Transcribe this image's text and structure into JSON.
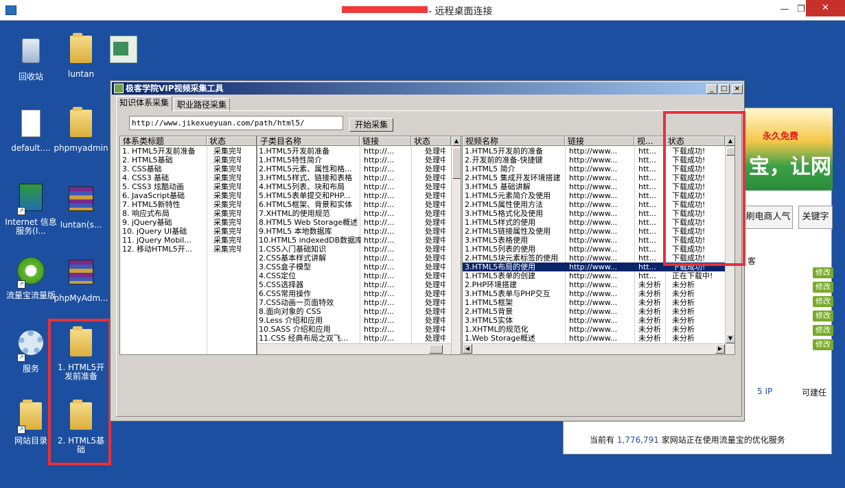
{
  "window": {
    "title": "- 远程桌面连接"
  },
  "desktop_icons": [
    {
      "label": "回收站"
    },
    {
      "label": "luntan"
    },
    {
      "label": "default...."
    },
    {
      "label": "phpmyadmin"
    },
    {
      "label": "Internet 信息服务(I..."
    },
    {
      "label": "luntan(s..."
    },
    {
      "label": "流量宝流量版"
    },
    {
      "label": "phpMyAdm..."
    },
    {
      "label": "服务"
    },
    {
      "label": "1. HTML5开发前准备"
    },
    {
      "label": "网站目录"
    },
    {
      "label": "2. HTML5基础"
    }
  ],
  "app": {
    "title": "极客学院VIP视频采集工具",
    "tabs": [
      "知识体系采集",
      "职业路径采集"
    ],
    "url": "http://www.jikexueyuan.com/path/html5/",
    "start_button": "开始采集",
    "list1": {
      "headers": [
        "体系类标题",
        "状态"
      ],
      "rows": [
        [
          "1. HTML5开发前准备",
          "采集完毕"
        ],
        [
          "2. HTML5基础",
          "采集完毕"
        ],
        [
          "3. CSS基础",
          "采集完毕"
        ],
        [
          "4. CSS3 基础",
          "采集完毕"
        ],
        [
          "5. CSS3 炫酷动画",
          "采集完毕"
        ],
        [
          "6. JavaScript基础",
          "采集完毕"
        ],
        [
          "7. HTML5新特性",
          "采集完毕"
        ],
        [
          "8. 响应式布局",
          "采集完毕"
        ],
        [
          "9. jQuery基础",
          "采集完毕"
        ],
        [
          "10. jQuery UI基础",
          "采集完毕"
        ],
        [
          "11. jQuery Mobil...",
          "采集完毕"
        ],
        [
          "12. 移动HTML5开...",
          "采集完毕"
        ]
      ]
    },
    "list2": {
      "headers": [
        "子类目名称",
        "链接",
        "状态"
      ],
      "rows": [
        [
          "1.HTML5开发前准备",
          "http://...",
          "处理中"
        ],
        [
          "1.HTML5特性简介",
          "http://...",
          "处理中"
        ],
        [
          "2.HTML5元素、属性和格...",
          "http://...",
          "处理中"
        ],
        [
          "3.HTML5样式、链接和表格",
          "http://...",
          "处理中"
        ],
        [
          "4.HTML5列表、块和布局",
          "http://...",
          "处理中"
        ],
        [
          "5.HTML5表单提交和PHP...",
          "http://...",
          "处理中"
        ],
        [
          "6.HTML5框架、背景和实体",
          "http://...",
          "处理中"
        ],
        [
          "7.XHTML的使用规范",
          "http://...",
          "处理中"
        ],
        [
          "8.HTML5 Web Storage概述",
          "http://...",
          "处理中"
        ],
        [
          "9.HTML5 本地数据库",
          "http://...",
          "处理中"
        ],
        [
          "10.HTML5 indexedDB数据库",
          "http://...",
          "处理中"
        ],
        [
          "1.CSS入门基础知识",
          "http://...",
          "处理中"
        ],
        [
          "2.CSS基本样式讲解",
          "http://...",
          "处理中"
        ],
        [
          "3.CSS盒子模型",
          "http://...",
          "处理中"
        ],
        [
          "4.CSS定位",
          "http://...",
          "处理中"
        ],
        [
          "5.CSS选择器",
          "http://...",
          "处理中"
        ],
        [
          "6.CSS常用操作",
          "http://...",
          "处理中"
        ],
        [
          "7.CSS动画一页面特效",
          "http://...",
          "处理中"
        ],
        [
          "8.面向对象的 CSS",
          "http://...",
          "处理中"
        ],
        [
          "9.Less 介绍和应用",
          "http://...",
          "处理中"
        ],
        [
          "10.SASS 介绍和应用",
          "http://...",
          "处理中"
        ],
        [
          "11.CSS 经典布局之双飞...",
          "http://...",
          "处理中"
        ]
      ]
    },
    "list3": {
      "headers": [
        "视频名称",
        "链接",
        "视...",
        "状态"
      ],
      "rows": [
        [
          "1.HTML5开发前的准备",
          "http://www...",
          "htt...",
          "下载成功!"
        ],
        [
          "2.开发前的准备-快捷键",
          "http://www...",
          "htt...",
          "下载成功!"
        ],
        [
          "1.HTML5 简介",
          "http://www...",
          "htt...",
          "下载成功!"
        ],
        [
          "2.HTML5 集成开发环境搭建",
          "http://www...",
          "htt...",
          "下载成功!"
        ],
        [
          "3.HTML5 基础讲解",
          "http://www...",
          "htt...",
          "下载成功!"
        ],
        [
          "1.HTML5元素简介及使用",
          "http://www...",
          "htt...",
          "下载成功!"
        ],
        [
          "2.HTML5属性使用方法",
          "http://www...",
          "htt...",
          "下载成功!"
        ],
        [
          "3.HTML5格式化及使用",
          "http://www...",
          "htt...",
          "下载成功!"
        ],
        [
          "1.HTML5样式的使用",
          "http://www...",
          "htt...",
          "下载成功!"
        ],
        [
          "2.HTML5链接属性及使用",
          "http://www...",
          "htt...",
          "下载成功!"
        ],
        [
          "3.HTML5表格使用",
          "http://www...",
          "htt...",
          "下载成功!"
        ],
        [
          "1.HTML5列表的使用",
          "http://www...",
          "htt...",
          "下载成功!"
        ],
        [
          "2.HTML5块元素标签的使用",
          "http://www...",
          "htt...",
          "下载成功!"
        ],
        [
          "3.HTML5布局的使用",
          "http://www...",
          "htt...",
          "下载成功!"
        ],
        [
          "1.HTML5表单的创建",
          "http://www...",
          "htt...",
          "正在下载中!"
        ],
        [
          "2.PHP环境搭建",
          "http://www...",
          "未分析",
          "未分析"
        ],
        [
          "3.HTML5表单与PHP交互",
          "http://www...",
          "未分析",
          "未分析"
        ],
        [
          "1.HTML5框架",
          "http://www...",
          "未分析",
          "未分析"
        ],
        [
          "2.HTML5背景",
          "http://www...",
          "未分析",
          "未分析"
        ],
        [
          "3.HTML5实体",
          "http://www...",
          "未分析",
          "未分析"
        ],
        [
          "1.XHTML的规范化",
          "http://www...",
          "未分析",
          "未分析"
        ],
        [
          "1.Web Storage概述",
          "http://www...",
          "未分析",
          "未分析"
        ]
      ],
      "selected_row": 13
    }
  },
  "background_window": {
    "banner_free": "永久免费",
    "banner_text": "宝，让网",
    "btn1": "刷电商人气",
    "btn2": "关键字",
    "modify": "修改",
    "ip_text": "5 IP",
    "build_text": "可建任",
    "footer_prefix": "当前有",
    "footer_count": "1,776,791",
    "footer_suffix": "家网站正在使用流量宝的优化服务",
    "partial": "客"
  },
  "colors": {
    "desktop": "#1c4fa0",
    "highlight": "#e8303a",
    "selection": "#0a246a"
  }
}
